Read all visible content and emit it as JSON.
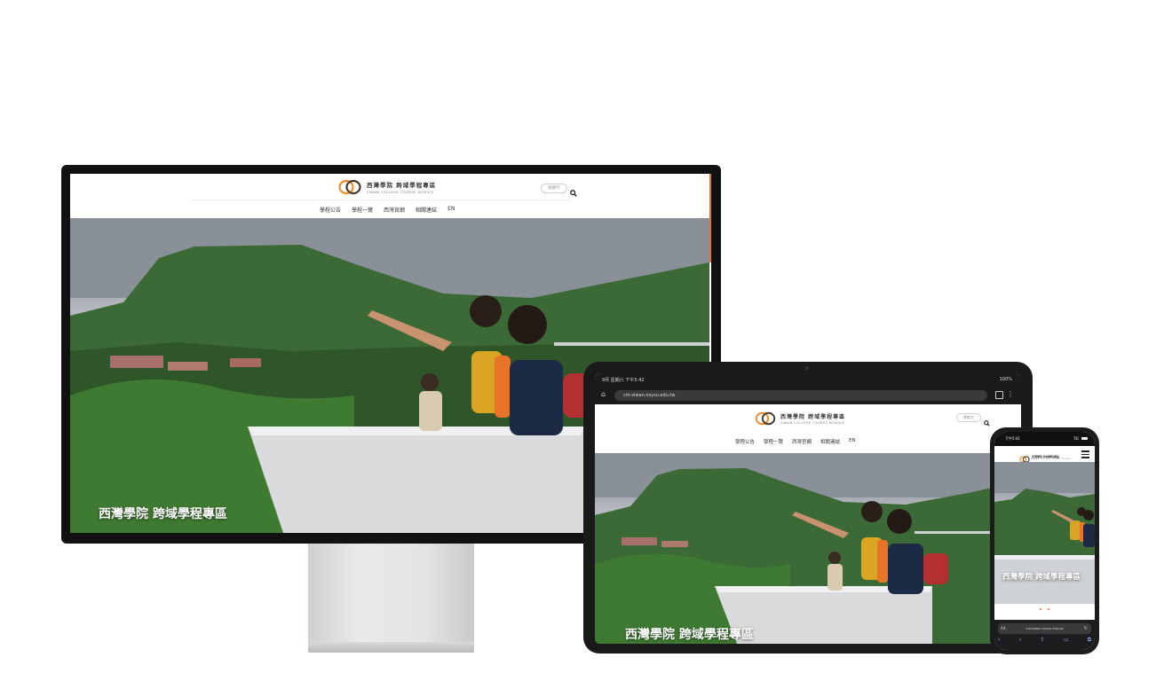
{
  "site": {
    "logo_zh": "西灣學院  跨域學程專區",
    "logo_en": "SIWAN COLLEGE COURSE MODULE",
    "search_placeholder": "關鍵字",
    "nav": [
      "學程公告",
      "學程一覽",
      "西灣官網",
      "相關連結",
      "EN"
    ],
    "hero_title": "西灣學院 跨域學程專區"
  },
  "tablet": {
    "status_time": "9月 星期六 下午5:42",
    "battery": "100%",
    "url": "cm-siwan.nsysu.edu.tw"
  },
  "phone": {
    "status_time": "下午5:41",
    "signal": "5G",
    "url": "cm-siwan.nsysu.edu.tw",
    "aa_label": "AA"
  },
  "colors": {
    "accent": "#e8742a",
    "logo_orange": "#f08c28",
    "logo_dark": "#4a3a2a"
  }
}
